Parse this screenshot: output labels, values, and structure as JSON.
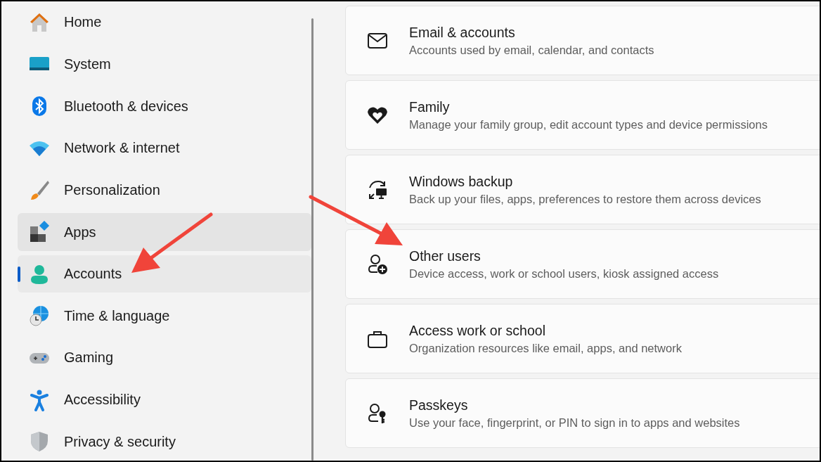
{
  "sidebar": {
    "items": [
      {
        "label": "Home",
        "selected": false,
        "hovered": false
      },
      {
        "label": "System",
        "selected": false,
        "hovered": false
      },
      {
        "label": "Bluetooth & devices",
        "selected": false,
        "hovered": false
      },
      {
        "label": "Network & internet",
        "selected": false,
        "hovered": false
      },
      {
        "label": "Personalization",
        "selected": false,
        "hovered": false
      },
      {
        "label": "Apps",
        "selected": false,
        "hovered": true
      },
      {
        "label": "Accounts",
        "selected": true,
        "hovered": false
      },
      {
        "label": "Time & language",
        "selected": false,
        "hovered": false
      },
      {
        "label": "Gaming",
        "selected": false,
        "hovered": false
      },
      {
        "label": "Accessibility",
        "selected": false,
        "hovered": false
      },
      {
        "label": "Privacy & security",
        "selected": false,
        "hovered": false
      }
    ]
  },
  "settings": [
    {
      "title": "Email & accounts",
      "description": "Accounts used by email, calendar, and contacts"
    },
    {
      "title": "Family",
      "description": "Manage your family group, edit account types and device permissions"
    },
    {
      "title": "Windows backup",
      "description": "Back up your files, apps, preferences to restore them across devices"
    },
    {
      "title": "Other users",
      "description": "Device access, work or school users, kiosk assigned access"
    },
    {
      "title": "Access work or school",
      "description": "Organization resources like email, apps, and network"
    },
    {
      "title": "Passkeys",
      "description": "Use your face, fingerprint, or PIN to sign in to apps and websites"
    }
  ]
}
